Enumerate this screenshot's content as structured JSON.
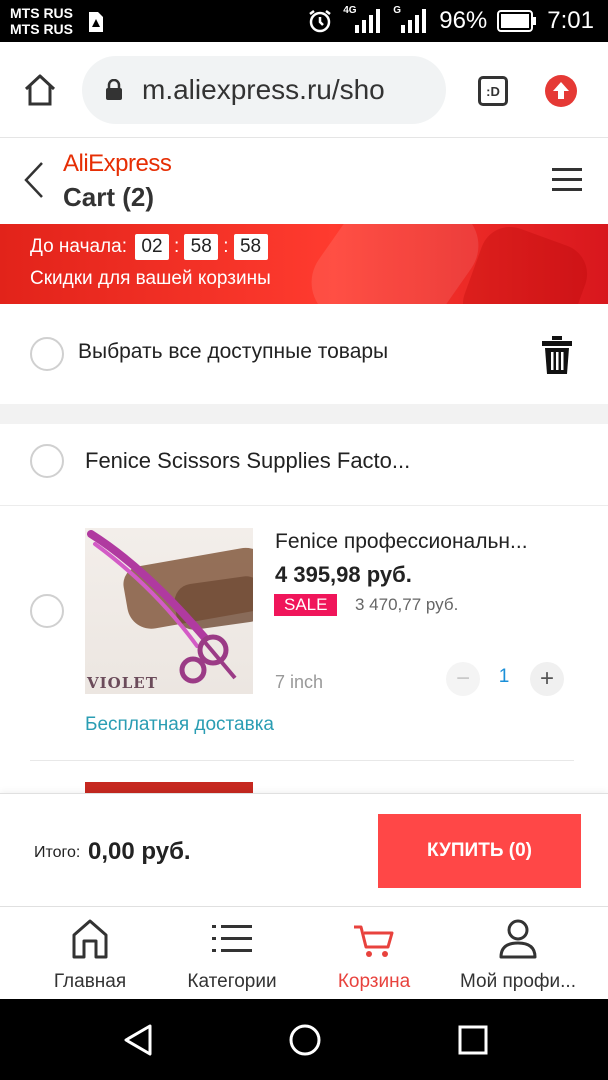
{
  "status_bar": {
    "carrier_1": "MTS RUS",
    "carrier_2": "MTS RUS",
    "network_1": "4G",
    "network_2": "G",
    "battery": "96%",
    "time": "7:01"
  },
  "browser": {
    "url": "m.aliexpress.ru/sho",
    "tabs_badge": ":D"
  },
  "header": {
    "brand": "AliExpress",
    "title": "Cart (2)"
  },
  "promo": {
    "countdown_label": "До начала:",
    "hours": "02",
    "minutes": "58",
    "seconds": "58",
    "separator": ":",
    "subtitle": "Скидки для вашей корзины"
  },
  "select_all": {
    "label": "Выбрать все доступные товары"
  },
  "store": {
    "name": "Fenice Scissors Supplies Facto..."
  },
  "product": {
    "title": "Fenice профессиональн...",
    "price": "4 395,98 руб.",
    "sale_badge": "SALE",
    "old_price": "3 470,77 руб.",
    "image_label": "VIOLET",
    "variant": "7 inch",
    "quantity": "1",
    "minus": "−",
    "plus": "+",
    "shipping": "Бесплатная доставка"
  },
  "checkout": {
    "total_label": "Итого:",
    "total_value": "0,00 руб.",
    "buy_label": "КУПИТЬ (0)"
  },
  "bottom_nav": {
    "items": [
      {
        "label": "Главная",
        "icon": "home-icon"
      },
      {
        "label": "Категории",
        "icon": "list-icon"
      },
      {
        "label": "Корзина",
        "icon": "cart-icon",
        "active": true
      },
      {
        "label": "Мой профи...",
        "icon": "profile-icon"
      }
    ]
  },
  "colors": {
    "accent": "#e62e04",
    "buy_button": "#ff4747",
    "sale_badge": "#f0155a",
    "shipping_text": "#2a9db3",
    "quantity_text": "#1a8fd8",
    "active_nav": "#e8423d"
  }
}
